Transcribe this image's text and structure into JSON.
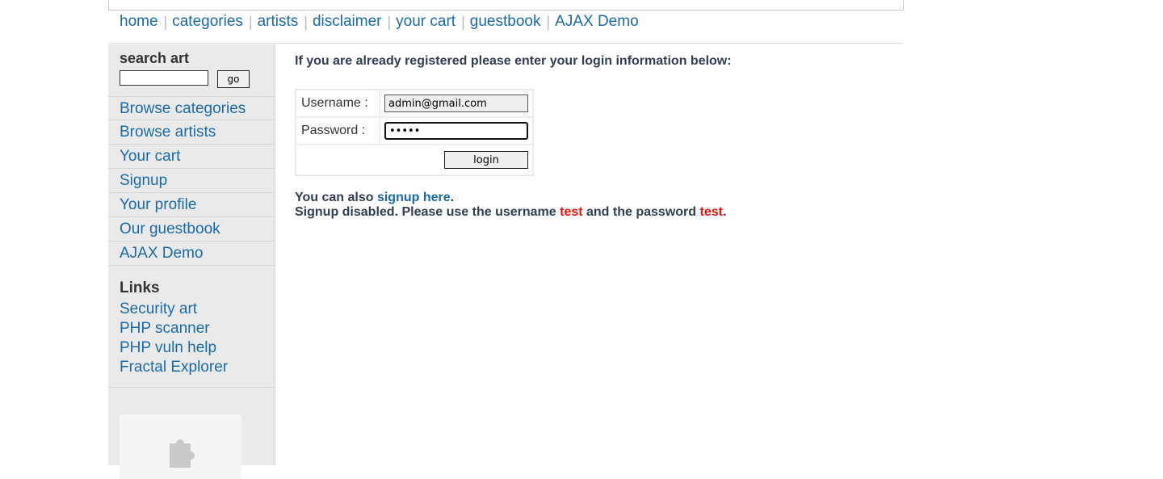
{
  "topnav": {
    "items": [
      "home",
      "categories",
      "artists",
      "disclaimer",
      "your cart",
      "guestbook",
      "AJAX Demo"
    ],
    "separator": "|"
  },
  "sidebar": {
    "search_title": "search art",
    "search_value": "",
    "go_label": "go",
    "menu": [
      "Browse categories",
      "Browse artists",
      "Your cart",
      "Signup",
      "Your profile",
      "Our guestbook",
      "AJAX Demo"
    ],
    "links_title": "Links",
    "links": [
      "Security art",
      "PHP scanner",
      "PHP vuln help",
      "Fractal Explorer"
    ],
    "extension_icon": "puzzle-piece-icon"
  },
  "main": {
    "intro": "If you are already registered please enter your login information below:",
    "username_label": "Username :",
    "username_value": "admin@gmail.com",
    "password_label": "Password :",
    "password_value": "•••••",
    "login_label": "login",
    "signup_prefix": "You can also ",
    "signup_link": "signup here",
    "signup_suffix": ".",
    "disabled_prefix": "Signup disabled. Please use the username ",
    "disabled_user": "test",
    "disabled_mid": " and the password ",
    "disabled_pass": "test",
    "disabled_suffix": "."
  },
  "colors": {
    "link": "#1a6aa8",
    "highlight": "#e8140c",
    "sidebar_bg": "#eaeaea"
  }
}
